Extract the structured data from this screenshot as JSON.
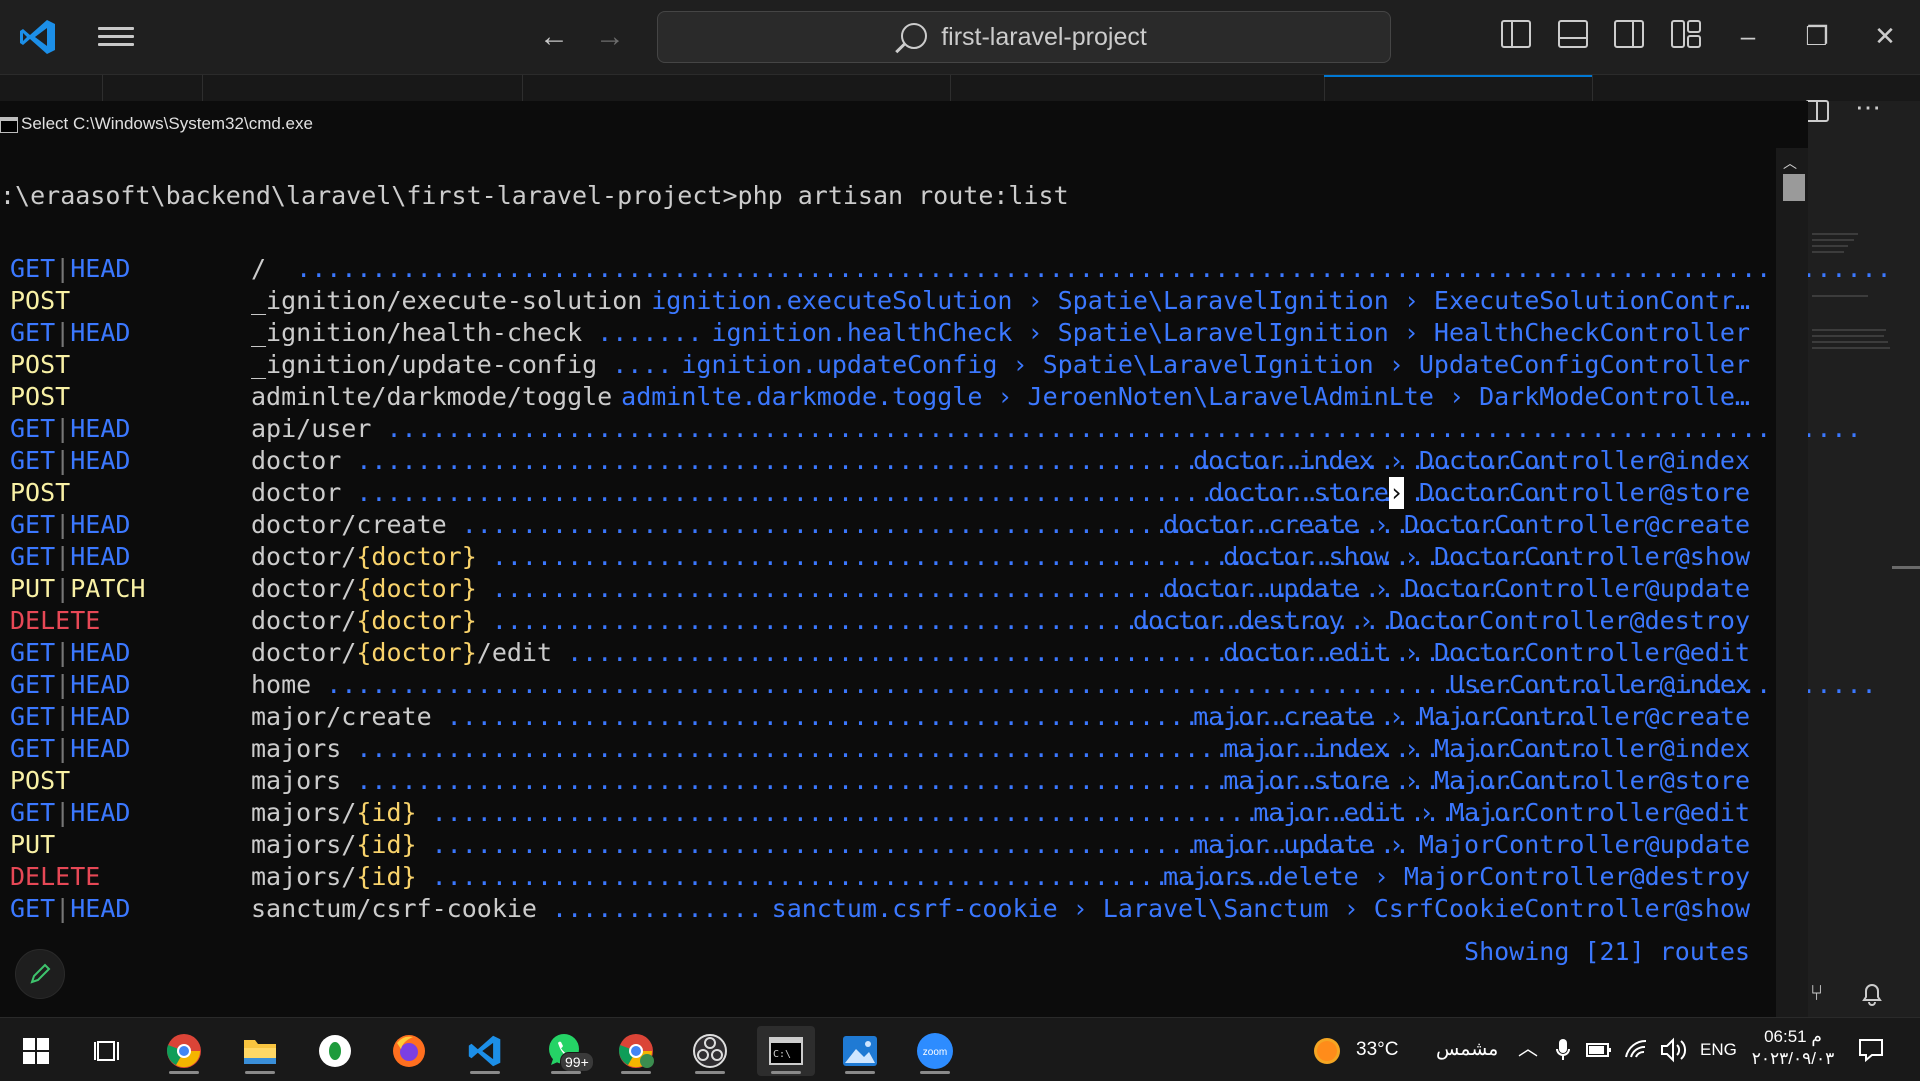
{
  "titlebar": {
    "search_text": "first-laravel-project"
  },
  "cmd": {
    "title": "Select C:\\Windows\\System32\\cmd.exe",
    "prompt": ":\\eraasoft\\backend\\laravel\\first-laravel-project>php artisan route:list",
    "routes": [
      {
        "methods": [
          "GET",
          "HEAD"
        ],
        "uri": [
          {
            "t": "/"
          }
        ],
        "dots": "  ..........................................................................................................",
        "right": ""
      },
      {
        "methods": [
          "POST"
        ],
        "uri": [
          {
            "t": "_ignition/execute-solution"
          }
        ],
        "dots": " ",
        "right": "ignition.executeSolution › Spatie\\LaravelIgnition › ExecuteSolutionContr…"
      },
      {
        "methods": [
          "GET",
          "HEAD"
        ],
        "uri": [
          {
            "t": "_ignition/health-check"
          }
        ],
        "dots": " ....... ",
        "right": "ignition.healthCheck › Spatie\\LaravelIgnition › HealthCheckController"
      },
      {
        "methods": [
          "POST"
        ],
        "uri": [
          {
            "t": "_ignition/update-config"
          }
        ],
        "dots": " .... ",
        "right": "ignition.updateConfig › Spatie\\LaravelIgnition › UpdateConfigController"
      },
      {
        "methods": [
          "POST"
        ],
        "uri": [
          {
            "t": "adminlte/darkmode/toggle"
          }
        ],
        "dots": " ",
        "right": "adminlte.darkmode.toggle › JeroenNoten\\LaravelAdminLte › DarkModeControlle…"
      },
      {
        "methods": [
          "GET",
          "HEAD"
        ],
        "uri": [
          {
            "t": "api/user"
          }
        ],
        "dots": " ..................................................................................................",
        "right": ""
      },
      {
        "methods": [
          "GET",
          "HEAD"
        ],
        "uri": [
          {
            "t": "doctor"
          }
        ],
        "dots": " ................................................................................ ",
        "right": "doctor.index › DoctorController@index"
      },
      {
        "methods": [
          "POST"
        ],
        "uri": [
          {
            "t": "doctor"
          }
        ],
        "dots": " ................................................................................ ",
        "right": "doctor.store",
        "cursor": "›",
        "right2": " DoctorController@store"
      },
      {
        "methods": [
          "GET",
          "HEAD"
        ],
        "uri": [
          {
            "t": "doctor/create"
          }
        ],
        "dots": " ....................................................................... ",
        "right": "doctor.create › DoctorController@create"
      },
      {
        "methods": [
          "GET",
          "HEAD"
        ],
        "uri": [
          {
            "t": "doctor/"
          },
          {
            "t": "{doctor}",
            "p": true
          }
        ],
        "dots": " ........................................................................ ",
        "right": "doctor.show › DoctorController@show"
      },
      {
        "methods": [
          "PUT",
          "PATCH"
        ],
        "uri": [
          {
            "t": "doctor/"
          },
          {
            "t": "{doctor}",
            "p": true
          }
        ],
        "dots": " .................................................................... ",
        "right": "doctor.update › DoctorController@update"
      },
      {
        "methods": [
          "DELETE"
        ],
        "uri": [
          {
            "t": "doctor/"
          },
          {
            "t": "{doctor}",
            "p": true
          }
        ],
        "dots": " ................................................................. ",
        "right": "doctor.destroy › DoctorController@destroy"
      },
      {
        "methods": [
          "GET",
          "HEAD"
        ],
        "uri": [
          {
            "t": "doctor/"
          },
          {
            "t": "{doctor}",
            "p": true
          },
          {
            "t": "/edit"
          }
        ],
        "dots": " ................................................................ ",
        "right": "doctor.edit › DoctorController@edit"
      },
      {
        "methods": [
          "GET",
          "HEAD"
        ],
        "uri": [
          {
            "t": "home"
          }
        ],
        "dots": " ....................................................................................................... ",
        "right": "UserController@index"
      },
      {
        "methods": [
          "GET",
          "HEAD"
        ],
        "uri": [
          {
            "t": "major/create"
          }
        ],
        "dots": " ............................................................................ ",
        "right": "major.create › MajorController@create"
      },
      {
        "methods": [
          "GET",
          "HEAD"
        ],
        "uri": [
          {
            "t": "majors"
          }
        ],
        "dots": " .................................................................................. ",
        "right": "major.index › MajorController@index"
      },
      {
        "methods": [
          "POST"
        ],
        "uri": [
          {
            "t": "majors"
          }
        ],
        "dots": " .................................................................................. ",
        "right": "major.store › MajorController@store"
      },
      {
        "methods": [
          "GET",
          "HEAD"
        ],
        "uri": [
          {
            "t": "majors/"
          },
          {
            "t": "{id}",
            "p": true
          }
        ],
        "dots": " ......................................................................... ",
        "right": "major.edit › MajorController@edit"
      },
      {
        "methods": [
          "PUT"
        ],
        "uri": [
          {
            "t": "majors/"
          },
          {
            "t": "{id}",
            "p": true
          }
        ],
        "dots": " ................................................................. ",
        "right": "major.update › MajorController@update"
      },
      {
        "methods": [
          "DELETE"
        ],
        "uri": [
          {
            "t": "majors/"
          },
          {
            "t": "{id}",
            "p": true
          }
        ],
        "dots": " ........................................................ ",
        "right": "majors.delete › MajorController@destroy"
      },
      {
        "methods": [
          "GET",
          "HEAD"
        ],
        "uri": [
          {
            "t": "sanctum/csrf-cookie"
          }
        ],
        "dots": " .............. ",
        "right": "sanctum.csrf-cookie › Laravel\\Sanctum › CsrfCookieController@show"
      }
    ],
    "showing": "Showing [21] routes"
  },
  "taskbar": {
    "whatsapp_badge": "99+",
    "weather_temp": "33°C",
    "weather_text": "مشمس",
    "language": "ENG",
    "time": "06:51 م",
    "date": "٢٠٢٣/٠٩/٠٣"
  },
  "colors": {
    "get": "#3b78ff",
    "post": "#f9f1a5",
    "delete": "#e74856",
    "param": "#f9d36b",
    "accent": "#0078d4"
  }
}
